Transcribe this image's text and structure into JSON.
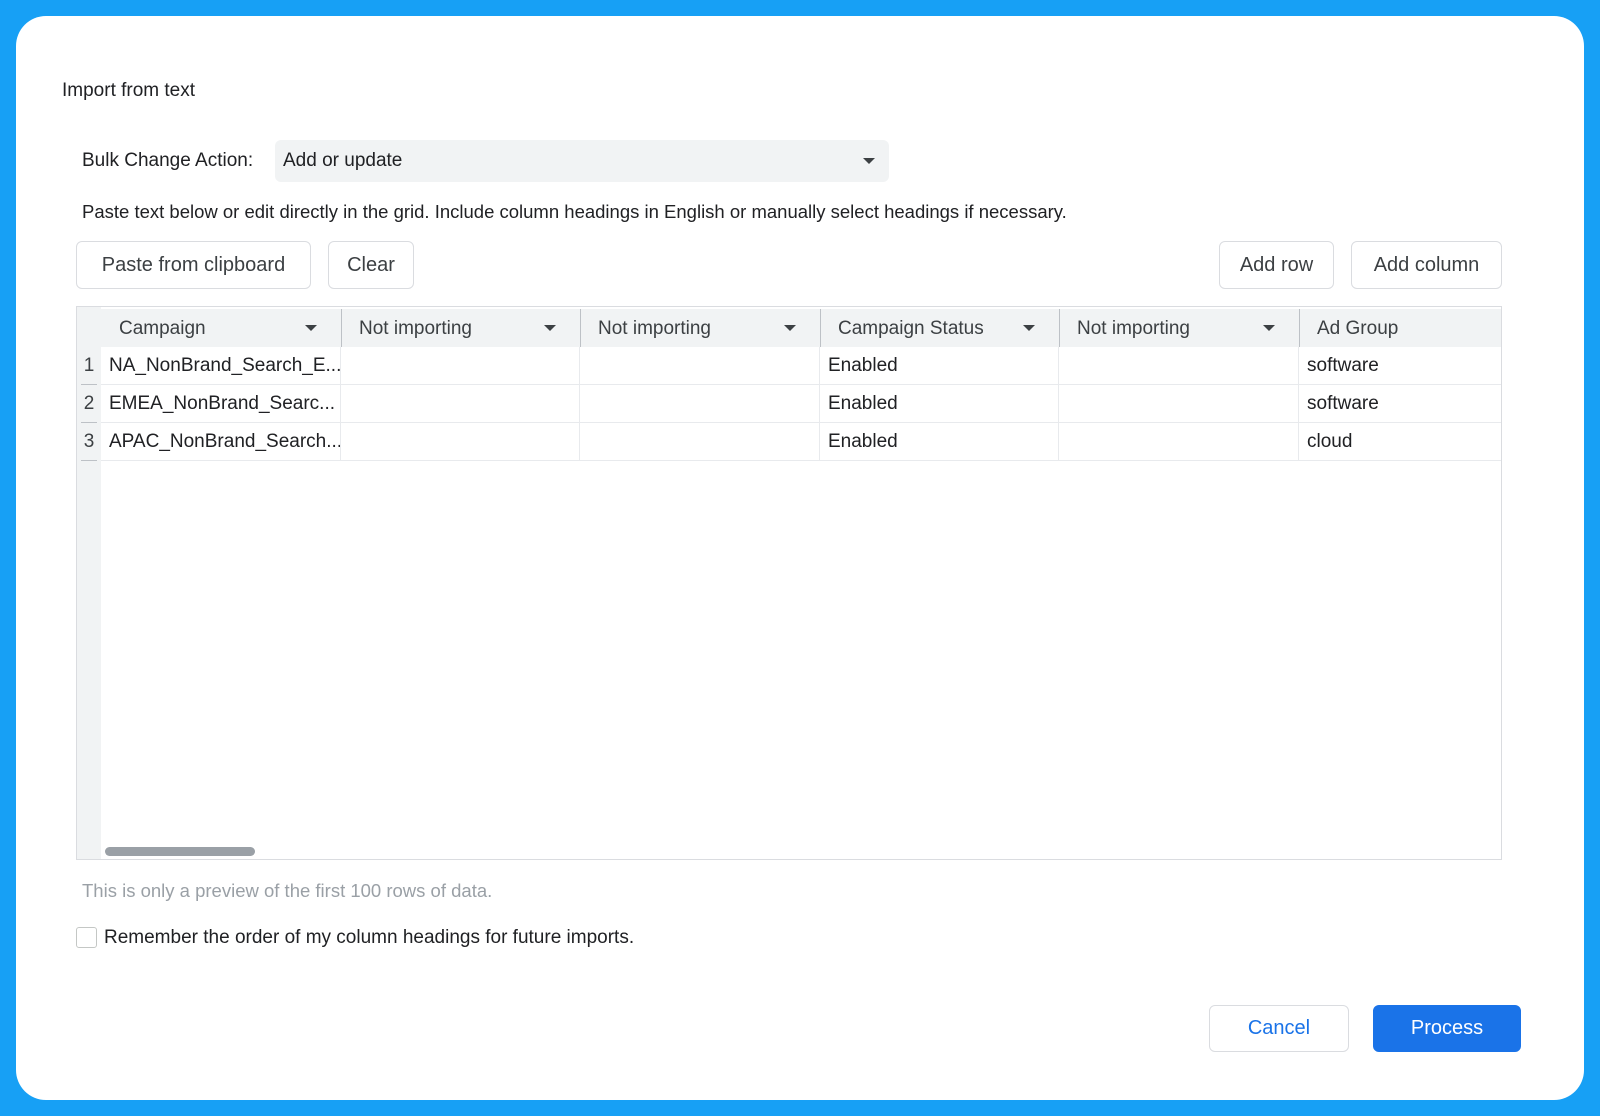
{
  "dialog": {
    "title": "Import from text"
  },
  "bulk": {
    "label": "Bulk Change Action:",
    "value": "Add or update"
  },
  "instructions": "Paste text below or edit directly in the grid. Include column headings in English or manually select headings if necessary.",
  "toolbar": {
    "paste": "Paste from clipboard",
    "clear": "Clear",
    "add_row": "Add row",
    "add_column": "Add column"
  },
  "grid": {
    "headers": [
      {
        "label": "Campaign",
        "dropdown": true
      },
      {
        "label": "Not importing",
        "dropdown": true
      },
      {
        "label": "Not importing",
        "dropdown": true
      },
      {
        "label": "Campaign Status",
        "dropdown": true
      },
      {
        "label": "Not importing",
        "dropdown": true
      },
      {
        "label": "Ad Group",
        "dropdown": false
      }
    ],
    "rows": [
      {
        "num": "1",
        "cells": [
          "NA_NonBrand_Search_E...",
          "",
          "",
          "Enabled",
          "",
          "software"
        ]
      },
      {
        "num": "2",
        "cells": [
          "EMEA_NonBrand_Searc...",
          "",
          "",
          "Enabled",
          "",
          "software"
        ]
      },
      {
        "num": "3",
        "cells": [
          "APAC_NonBrand_Search...",
          "",
          "",
          "Enabled",
          "",
          "cloud"
        ]
      }
    ]
  },
  "preview_note": "This is only a preview of the first 100 rows of data.",
  "remember": {
    "label": "Remember the order of my column headings for future imports.",
    "checked": false
  },
  "footer": {
    "cancel": "Cancel",
    "process": "Process"
  },
  "colors": {
    "background": "#17a0f5",
    "primary": "#1a73e8"
  }
}
